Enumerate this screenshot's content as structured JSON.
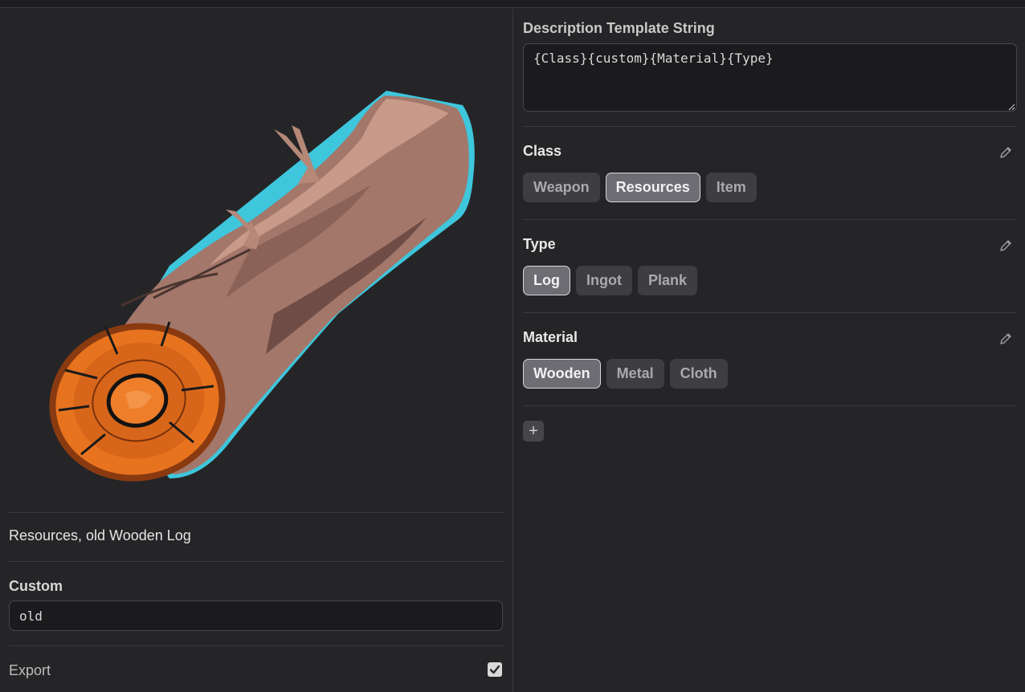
{
  "left": {
    "description_output": "Resources, old Wooden Log",
    "custom_label": "Custom",
    "custom_value": "old",
    "export_label": "Export",
    "export_checked": true
  },
  "right": {
    "template_label": "Description Template String",
    "template_value": "{Class}{custom}{Material}{Type}",
    "sections": [
      {
        "title": "Class",
        "chips": [
          "Weapon",
          "Resources",
          "Item"
        ],
        "selected": "Resources"
      },
      {
        "title": "Type",
        "chips": [
          "Log",
          "Ingot",
          "Plank"
        ],
        "selected": "Log"
      },
      {
        "title": "Material",
        "chips": [
          "Wooden",
          "Metal",
          "Cloth"
        ],
        "selected": "Wooden"
      }
    ],
    "add_label": "+"
  },
  "icons": {
    "edit": "pencil-icon",
    "add": "plus-icon",
    "check": "check-icon"
  },
  "colors": {
    "background": "#252528",
    "chip": "#3d3d42",
    "chip_active": "#6d6d73",
    "log_rim": "#3ec6dc",
    "log_core": "#e8731f"
  }
}
